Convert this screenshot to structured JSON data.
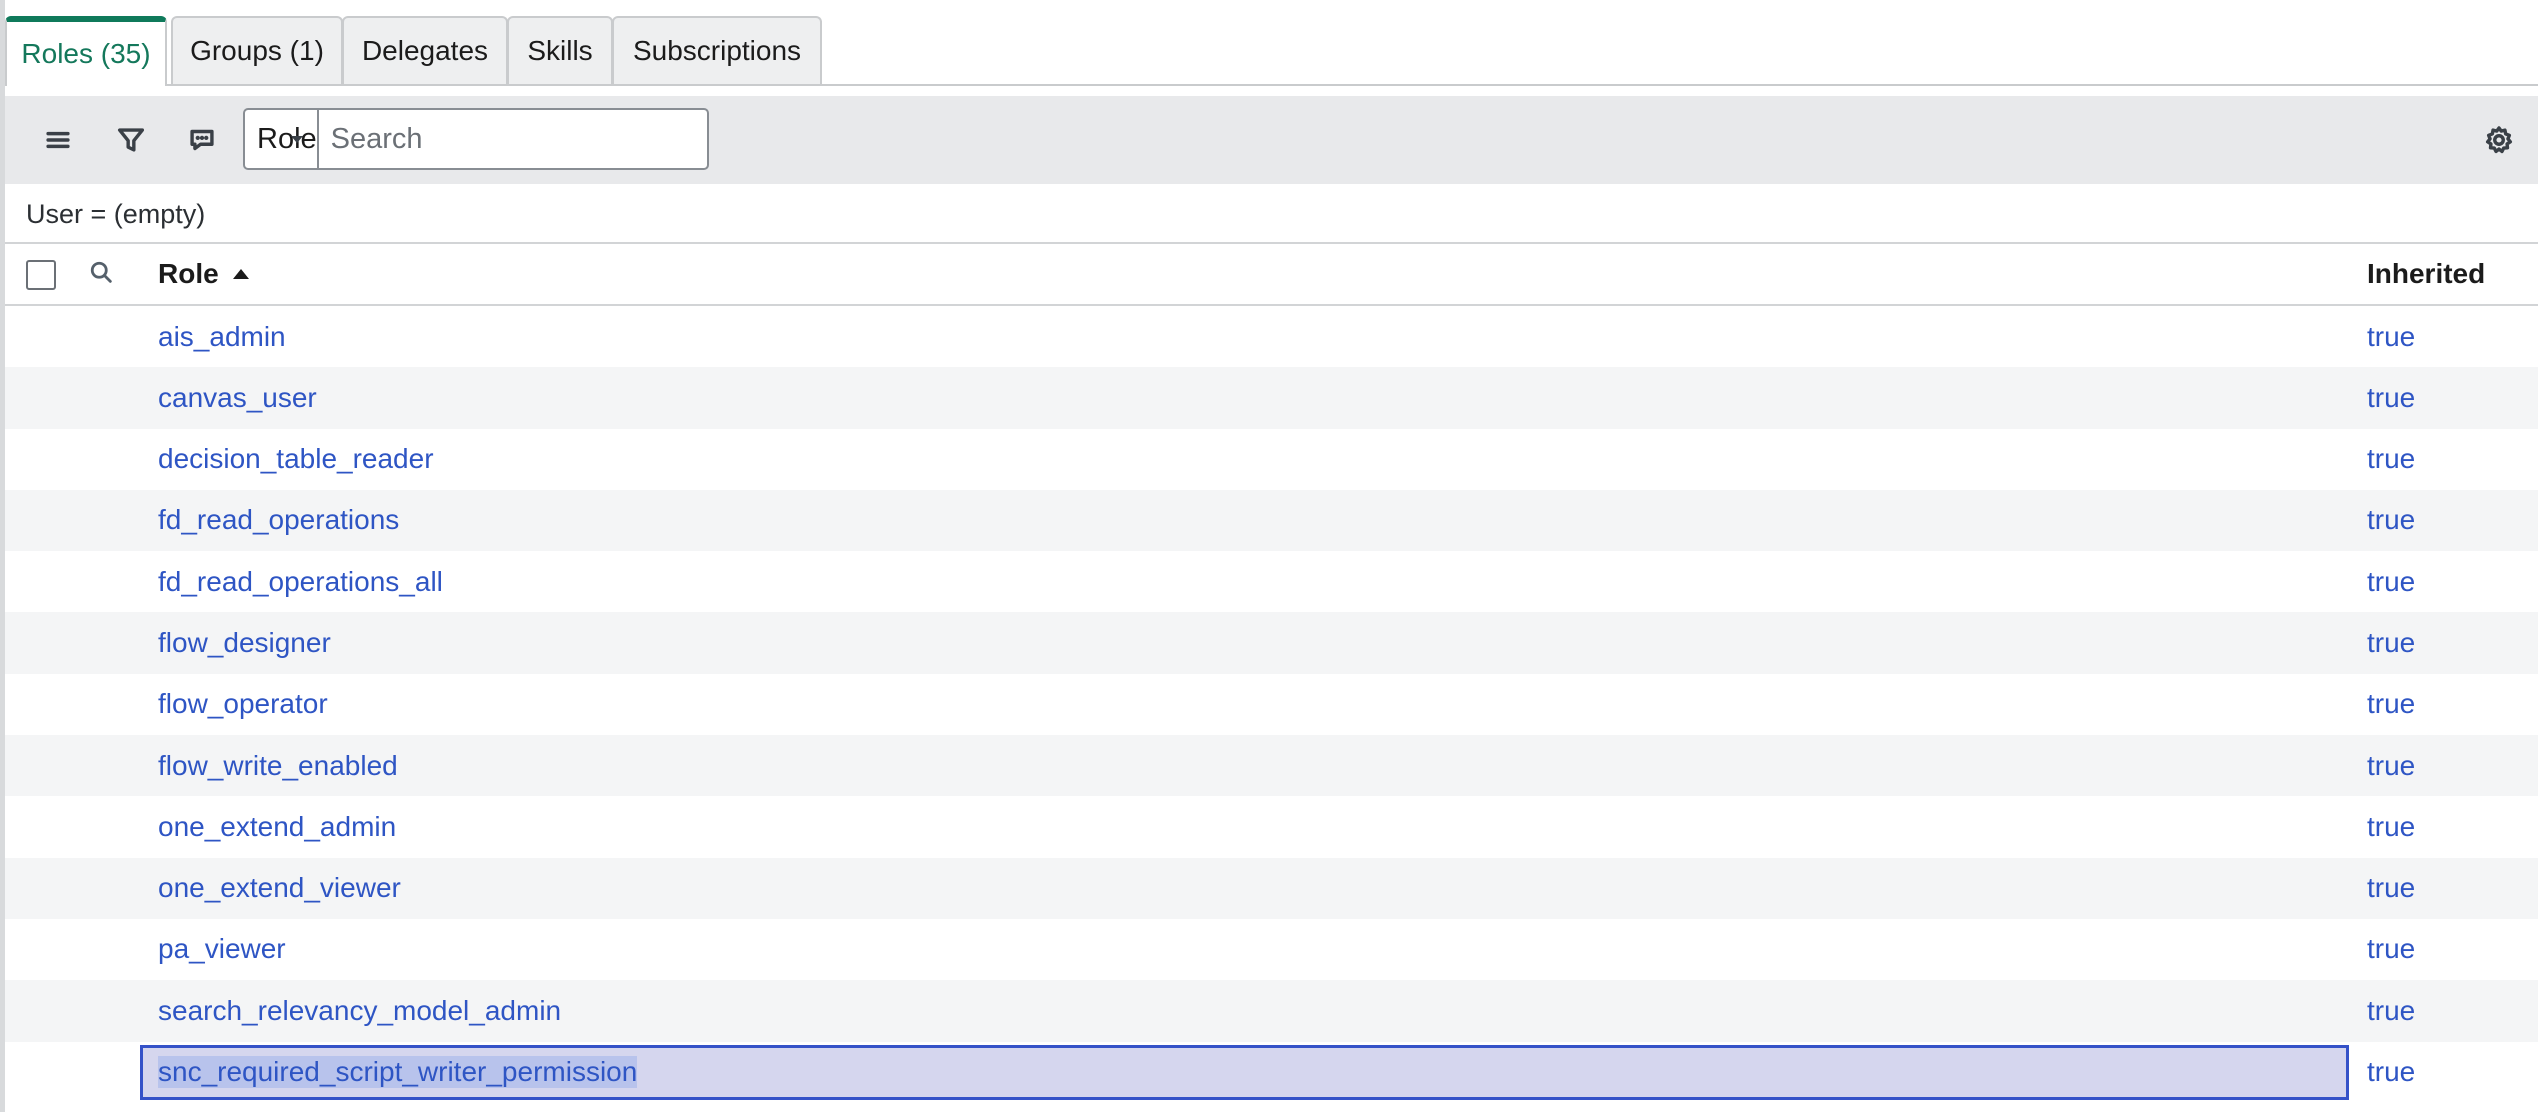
{
  "tabs": [
    {
      "label": "Roles (35)",
      "active": true
    },
    {
      "label": "Groups (1)",
      "active": false
    },
    {
      "label": "Delegates",
      "active": false
    },
    {
      "label": "Skills",
      "active": false
    },
    {
      "label": "Subscriptions",
      "active": false
    }
  ],
  "toolbar": {
    "menu_icon": "hamburger-menu-icon",
    "filter_icon": "funnel-icon",
    "comment_icon": "chat-bubble-icon",
    "search_field_select": "Role",
    "search_placeholder": "Search",
    "settings_icon": "gear-icon"
  },
  "filter_breadcrumb": "User = (empty)",
  "list": {
    "columns": [
      "Role",
      "Inherited"
    ],
    "sort": {
      "column": "Role",
      "direction": "ascending"
    },
    "rows": [
      {
        "role": "ais_admin",
        "inherited": "true"
      },
      {
        "role": "canvas_user",
        "inherited": "true"
      },
      {
        "role": "decision_table_reader",
        "inherited": "true"
      },
      {
        "role": "fd_read_operations",
        "inherited": "true"
      },
      {
        "role": "fd_read_operations_all",
        "inherited": "true"
      },
      {
        "role": "flow_designer",
        "inherited": "true"
      },
      {
        "role": "flow_operator",
        "inherited": "true"
      },
      {
        "role": "flow_write_enabled",
        "inherited": "true"
      },
      {
        "role": "one_extend_admin",
        "inherited": "true"
      },
      {
        "role": "one_extend_viewer",
        "inherited": "true"
      },
      {
        "role": "pa_viewer",
        "inherited": "true"
      },
      {
        "role": "search_relevancy_model_admin",
        "inherited": "true"
      },
      {
        "role": "snc_required_script_writer_permission",
        "inherited": "true",
        "selected": true
      }
    ]
  },
  "colors": {
    "active_tab": "#0f7a5b",
    "link": "#2e55c4",
    "selection_border": "#3552c8",
    "toolbar_bg": "#e8e9eb"
  }
}
